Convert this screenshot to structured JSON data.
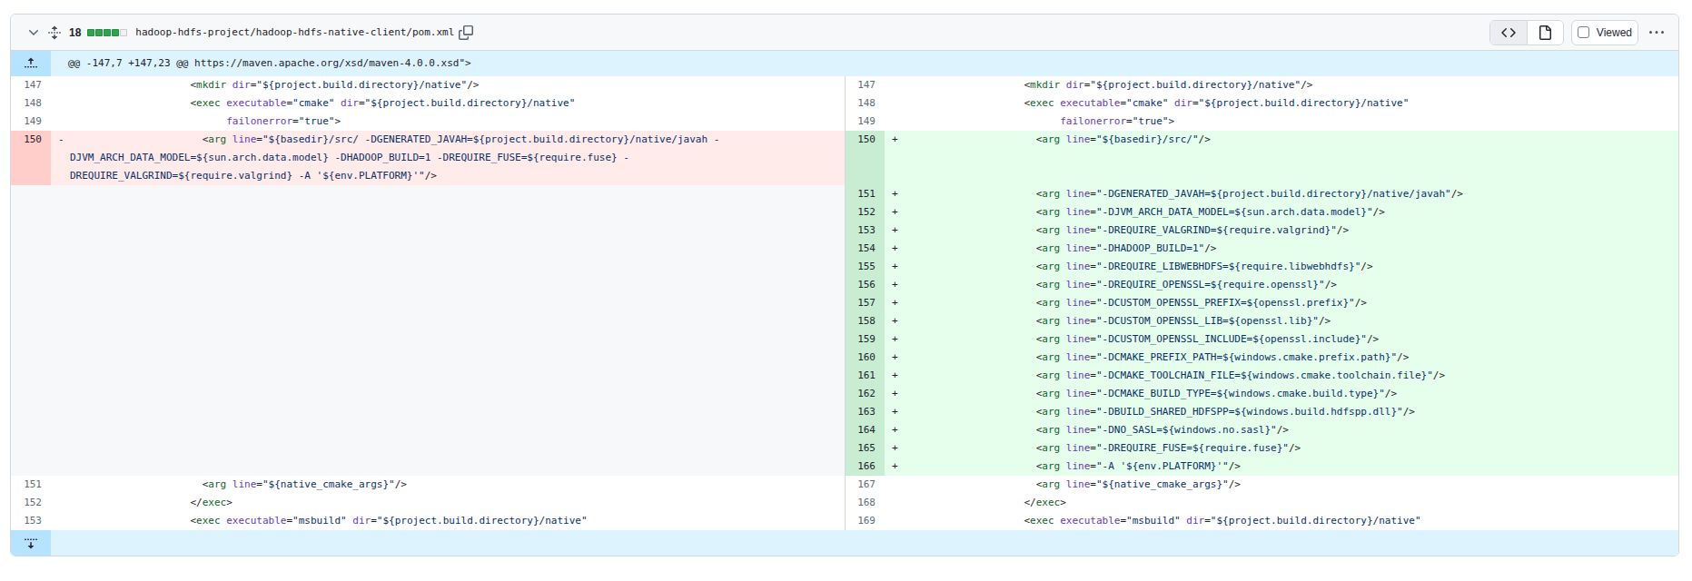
{
  "file_header": {
    "changes_count": "18",
    "diffstat": {
      "added_squares": 4,
      "deleted_squares": 0,
      "neutral_squares": 1
    },
    "file_path": "hadoop-hdfs-project/hadoop-hdfs-native-client/pom.xml",
    "viewed_label": "Viewed",
    "icons": [
      "chevron-down-icon",
      "unfold-icon",
      "copy-icon",
      "code-view-icon",
      "rich-file-icon",
      "kebab-horizontal-icon"
    ]
  },
  "hunk": {
    "header_text": "@@ -147,7 +147,23 @@ https://maven.apache.org/xsd/maven-4.0.0.xsd\">"
  },
  "colors": {
    "accent_hunk_bg": "#ddf4ff",
    "accent_hunk_num_bg": "#b6e3ff",
    "addition_line_bg": "#e6ffec",
    "addition_num_bg": "#c9edd3",
    "deletion_line_bg": "#ffebe9",
    "deletion_num_bg": "#ffcecb",
    "empty_cell_bg": "#f6f8fa",
    "border": "#d1d9e0",
    "header_bg": "#f6f8fa",
    "fg_default": "#1f2328",
    "fg_muted": "#636c76",
    "syntax_tag": "#116329",
    "syntax_attr": "#6639ba",
    "syntax_string": "#0a3069",
    "diffstat_green": "#2da44e",
    "diffstat_neutral": "#eff1f3"
  },
  "diff_rows": [
    {
      "left": {
        "kind": "ctx",
        "num": "147",
        "code": [
          [
            "p",
            "                    <"
          ],
          [
            "t",
            "mkdir"
          ],
          [
            "p",
            " "
          ],
          [
            "a",
            "dir"
          ],
          [
            "p",
            "="
          ],
          [
            "s",
            "\"${project.build.directory}/native\""
          ],
          [
            "p",
            "/>"
          ]
        ]
      },
      "right": {
        "kind": "ctx",
        "num": "147",
        "code": [
          [
            "p",
            "                    <"
          ],
          [
            "t",
            "mkdir"
          ],
          [
            "p",
            " "
          ],
          [
            "a",
            "dir"
          ],
          [
            "p",
            "="
          ],
          [
            "s",
            "\"${project.build.directory}/native\""
          ],
          [
            "p",
            "/>"
          ]
        ]
      }
    },
    {
      "left": {
        "kind": "ctx",
        "num": "148",
        "code": [
          [
            "p",
            "                    <"
          ],
          [
            "t",
            "exec"
          ],
          [
            "p",
            " "
          ],
          [
            "a",
            "executable"
          ],
          [
            "p",
            "="
          ],
          [
            "s",
            "\"cmake\""
          ],
          [
            "p",
            " "
          ],
          [
            "a",
            "dir"
          ],
          [
            "p",
            "="
          ],
          [
            "s",
            "\"${project.build.directory}/native\""
          ]
        ]
      },
      "right": {
        "kind": "ctx",
        "num": "148",
        "code": [
          [
            "p",
            "                    <"
          ],
          [
            "t",
            "exec"
          ],
          [
            "p",
            " "
          ],
          [
            "a",
            "executable"
          ],
          [
            "p",
            "="
          ],
          [
            "s",
            "\"cmake\""
          ],
          [
            "p",
            " "
          ],
          [
            "a",
            "dir"
          ],
          [
            "p",
            "="
          ],
          [
            "s",
            "\"${project.build.directory}/native\""
          ]
        ]
      }
    },
    {
      "left": {
        "kind": "ctx",
        "num": "149",
        "code": [
          [
            "p",
            "                          "
          ],
          [
            "a",
            "failonerror"
          ],
          [
            "p",
            "="
          ],
          [
            "s",
            "\"true\""
          ],
          [
            "p",
            ">"
          ]
        ]
      },
      "right": {
        "kind": "ctx",
        "num": "149",
        "code": [
          [
            "p",
            "                          "
          ],
          [
            "a",
            "failonerror"
          ],
          [
            "p",
            "="
          ],
          [
            "s",
            "\"true\""
          ],
          [
            "p",
            ">"
          ]
        ]
      }
    },
    {
      "left": {
        "kind": "del",
        "num": "150",
        "code": [
          [
            "p",
            "                      <"
          ],
          [
            "t",
            "arg"
          ],
          [
            "p",
            " "
          ],
          [
            "a",
            "line"
          ],
          [
            "p",
            "="
          ],
          [
            "s",
            "\"${basedir}/src/ -DGENERATED_JAVAH=${project.build.directory}/native/javah -DJVM_ARCH_DATA_MODEL=${sun.arch.data.model} -DHADOOP_BUILD=1 -DREQUIRE_FUSE=${require.fuse} -DREQUIRE_VALGRIND=${require.valgrind} -A '${env.PLATFORM}'\""
          ],
          [
            "p",
            "/>"
          ]
        ]
      },
      "right": {
        "kind": "add",
        "num": "150",
        "code": [
          [
            "p",
            "                      <"
          ],
          [
            "t",
            "arg"
          ],
          [
            "p",
            " "
          ],
          [
            "a",
            "line"
          ],
          [
            "p",
            "="
          ],
          [
            "s",
            "\"${basedir}/src/\""
          ],
          [
            "p",
            "/>"
          ]
        ]
      }
    },
    {
      "left": {
        "kind": "empty"
      },
      "right": {
        "kind": "add",
        "num": "151",
        "code": [
          [
            "p",
            "                      <"
          ],
          [
            "t",
            "arg"
          ],
          [
            "p",
            " "
          ],
          [
            "a",
            "line"
          ],
          [
            "p",
            "="
          ],
          [
            "s",
            "\"-DGENERATED_JAVAH=${project.build.directory}/native/javah\""
          ],
          [
            "p",
            "/>"
          ]
        ]
      }
    },
    {
      "left": {
        "kind": "empty"
      },
      "right": {
        "kind": "add",
        "num": "152",
        "code": [
          [
            "p",
            "                      <"
          ],
          [
            "t",
            "arg"
          ],
          [
            "p",
            " "
          ],
          [
            "a",
            "line"
          ],
          [
            "p",
            "="
          ],
          [
            "s",
            "\"-DJVM_ARCH_DATA_MODEL=${sun.arch.data.model}\""
          ],
          [
            "p",
            "/>"
          ]
        ]
      }
    },
    {
      "left": {
        "kind": "empty"
      },
      "right": {
        "kind": "add",
        "num": "153",
        "code": [
          [
            "p",
            "                      <"
          ],
          [
            "t",
            "arg"
          ],
          [
            "p",
            " "
          ],
          [
            "a",
            "line"
          ],
          [
            "p",
            "="
          ],
          [
            "s",
            "\"-DREQUIRE_VALGRIND=${require.valgrind}\""
          ],
          [
            "p",
            "/>"
          ]
        ]
      }
    },
    {
      "left": {
        "kind": "empty"
      },
      "right": {
        "kind": "add",
        "num": "154",
        "code": [
          [
            "p",
            "                      <"
          ],
          [
            "t",
            "arg"
          ],
          [
            "p",
            " "
          ],
          [
            "a",
            "line"
          ],
          [
            "p",
            "="
          ],
          [
            "s",
            "\"-DHADOOP_BUILD=1\""
          ],
          [
            "p",
            "/>"
          ]
        ]
      }
    },
    {
      "left": {
        "kind": "empty"
      },
      "right": {
        "kind": "add",
        "num": "155",
        "code": [
          [
            "p",
            "                      <"
          ],
          [
            "t",
            "arg"
          ],
          [
            "p",
            " "
          ],
          [
            "a",
            "line"
          ],
          [
            "p",
            "="
          ],
          [
            "s",
            "\"-DREQUIRE_LIBWEBHDFS=${require.libwebhdfs}\""
          ],
          [
            "p",
            "/>"
          ]
        ]
      }
    },
    {
      "left": {
        "kind": "empty"
      },
      "right": {
        "kind": "add",
        "num": "156",
        "code": [
          [
            "p",
            "                      <"
          ],
          [
            "t",
            "arg"
          ],
          [
            "p",
            " "
          ],
          [
            "a",
            "line"
          ],
          [
            "p",
            "="
          ],
          [
            "s",
            "\"-DREQUIRE_OPENSSL=${require.openssl}\""
          ],
          [
            "p",
            "/>"
          ]
        ]
      }
    },
    {
      "left": {
        "kind": "empty"
      },
      "right": {
        "kind": "add",
        "num": "157",
        "code": [
          [
            "p",
            "                      <"
          ],
          [
            "t",
            "arg"
          ],
          [
            "p",
            " "
          ],
          [
            "a",
            "line"
          ],
          [
            "p",
            "="
          ],
          [
            "s",
            "\"-DCUSTOM_OPENSSL_PREFIX=${openssl.prefix}\""
          ],
          [
            "p",
            "/>"
          ]
        ]
      }
    },
    {
      "left": {
        "kind": "empty"
      },
      "right": {
        "kind": "add",
        "num": "158",
        "code": [
          [
            "p",
            "                      <"
          ],
          [
            "t",
            "arg"
          ],
          [
            "p",
            " "
          ],
          [
            "a",
            "line"
          ],
          [
            "p",
            "="
          ],
          [
            "s",
            "\"-DCUSTOM_OPENSSL_LIB=${openssl.lib}\""
          ],
          [
            "p",
            "/>"
          ]
        ]
      }
    },
    {
      "left": {
        "kind": "empty"
      },
      "right": {
        "kind": "add",
        "num": "159",
        "code": [
          [
            "p",
            "                      <"
          ],
          [
            "t",
            "arg"
          ],
          [
            "p",
            " "
          ],
          [
            "a",
            "line"
          ],
          [
            "p",
            "="
          ],
          [
            "s",
            "\"-DCUSTOM_OPENSSL_INCLUDE=${openssl.include}\""
          ],
          [
            "p",
            "/>"
          ]
        ]
      }
    },
    {
      "left": {
        "kind": "empty"
      },
      "right": {
        "kind": "add",
        "num": "160",
        "code": [
          [
            "p",
            "                      <"
          ],
          [
            "t",
            "arg"
          ],
          [
            "p",
            " "
          ],
          [
            "a",
            "line"
          ],
          [
            "p",
            "="
          ],
          [
            "s",
            "\"-DCMAKE_PREFIX_PATH=${windows.cmake.prefix.path}\""
          ],
          [
            "p",
            "/>"
          ]
        ]
      }
    },
    {
      "left": {
        "kind": "empty"
      },
      "right": {
        "kind": "add",
        "num": "161",
        "code": [
          [
            "p",
            "                      <"
          ],
          [
            "t",
            "arg"
          ],
          [
            "p",
            " "
          ],
          [
            "a",
            "line"
          ],
          [
            "p",
            "="
          ],
          [
            "s",
            "\"-DCMAKE_TOOLCHAIN_FILE=${windows.cmake.toolchain.file}\""
          ],
          [
            "p",
            "/>"
          ]
        ]
      }
    },
    {
      "left": {
        "kind": "empty"
      },
      "right": {
        "kind": "add",
        "num": "162",
        "code": [
          [
            "p",
            "                      <"
          ],
          [
            "t",
            "arg"
          ],
          [
            "p",
            " "
          ],
          [
            "a",
            "line"
          ],
          [
            "p",
            "="
          ],
          [
            "s",
            "\"-DCMAKE_BUILD_TYPE=${windows.cmake.build.type}\""
          ],
          [
            "p",
            "/>"
          ]
        ]
      }
    },
    {
      "left": {
        "kind": "empty"
      },
      "right": {
        "kind": "add",
        "num": "163",
        "code": [
          [
            "p",
            "                      <"
          ],
          [
            "t",
            "arg"
          ],
          [
            "p",
            " "
          ],
          [
            "a",
            "line"
          ],
          [
            "p",
            "="
          ],
          [
            "s",
            "\"-DBUILD_SHARED_HDFSPP=${windows.build.hdfspp.dll}\""
          ],
          [
            "p",
            "/>"
          ]
        ]
      }
    },
    {
      "left": {
        "kind": "empty"
      },
      "right": {
        "kind": "add",
        "num": "164",
        "code": [
          [
            "p",
            "                      <"
          ],
          [
            "t",
            "arg"
          ],
          [
            "p",
            " "
          ],
          [
            "a",
            "line"
          ],
          [
            "p",
            "="
          ],
          [
            "s",
            "\"-DNO_SASL=${windows.no.sasl}\""
          ],
          [
            "p",
            "/>"
          ]
        ]
      }
    },
    {
      "left": {
        "kind": "empty"
      },
      "right": {
        "kind": "add",
        "num": "165",
        "code": [
          [
            "p",
            "                      <"
          ],
          [
            "t",
            "arg"
          ],
          [
            "p",
            " "
          ],
          [
            "a",
            "line"
          ],
          [
            "p",
            "="
          ],
          [
            "s",
            "\"-DREQUIRE_FUSE=${require.fuse}\""
          ],
          [
            "p",
            "/>"
          ]
        ]
      }
    },
    {
      "left": {
        "kind": "empty"
      },
      "right": {
        "kind": "add",
        "num": "166",
        "code": [
          [
            "p",
            "                      <"
          ],
          [
            "t",
            "arg"
          ],
          [
            "p",
            " "
          ],
          [
            "a",
            "line"
          ],
          [
            "p",
            "="
          ],
          [
            "s",
            "\"-A '${env.PLATFORM}'\""
          ],
          [
            "p",
            "/>"
          ]
        ]
      }
    },
    {
      "left": {
        "kind": "ctx",
        "num": "151",
        "code": [
          [
            "p",
            "                      <"
          ],
          [
            "t",
            "arg"
          ],
          [
            "p",
            " "
          ],
          [
            "a",
            "line"
          ],
          [
            "p",
            "="
          ],
          [
            "s",
            "\"${native_cmake_args}\""
          ],
          [
            "p",
            "/>"
          ]
        ]
      },
      "right": {
        "kind": "ctx",
        "num": "167",
        "code": [
          [
            "p",
            "                      <"
          ],
          [
            "t",
            "arg"
          ],
          [
            "p",
            " "
          ],
          [
            "a",
            "line"
          ],
          [
            "p",
            "="
          ],
          [
            "s",
            "\"${native_cmake_args}\""
          ],
          [
            "p",
            "/>"
          ]
        ]
      }
    },
    {
      "left": {
        "kind": "ctx",
        "num": "152",
        "code": [
          [
            "p",
            "                    </"
          ],
          [
            "t",
            "exec"
          ],
          [
            "p",
            ">"
          ]
        ]
      },
      "right": {
        "kind": "ctx",
        "num": "168",
        "code": [
          [
            "p",
            "                    </"
          ],
          [
            "t",
            "exec"
          ],
          [
            "p",
            ">"
          ]
        ]
      }
    },
    {
      "left": {
        "kind": "ctx",
        "num": "153",
        "code": [
          [
            "p",
            "                    <"
          ],
          [
            "t",
            "exec"
          ],
          [
            "p",
            " "
          ],
          [
            "a",
            "executable"
          ],
          [
            "p",
            "="
          ],
          [
            "s",
            "\"msbuild\""
          ],
          [
            "p",
            " "
          ],
          [
            "a",
            "dir"
          ],
          [
            "p",
            "="
          ],
          [
            "s",
            "\"${project.build.directory}/native\""
          ]
        ]
      },
      "right": {
        "kind": "ctx",
        "num": "169",
        "code": [
          [
            "p",
            "                    <"
          ],
          [
            "t",
            "exec"
          ],
          [
            "p",
            " "
          ],
          [
            "a",
            "executable"
          ],
          [
            "p",
            "="
          ],
          [
            "s",
            "\"msbuild\""
          ],
          [
            "p",
            " "
          ],
          [
            "a",
            "dir"
          ],
          [
            "p",
            "="
          ],
          [
            "s",
            "\"${project.build.directory}/native\""
          ]
        ]
      }
    }
  ]
}
